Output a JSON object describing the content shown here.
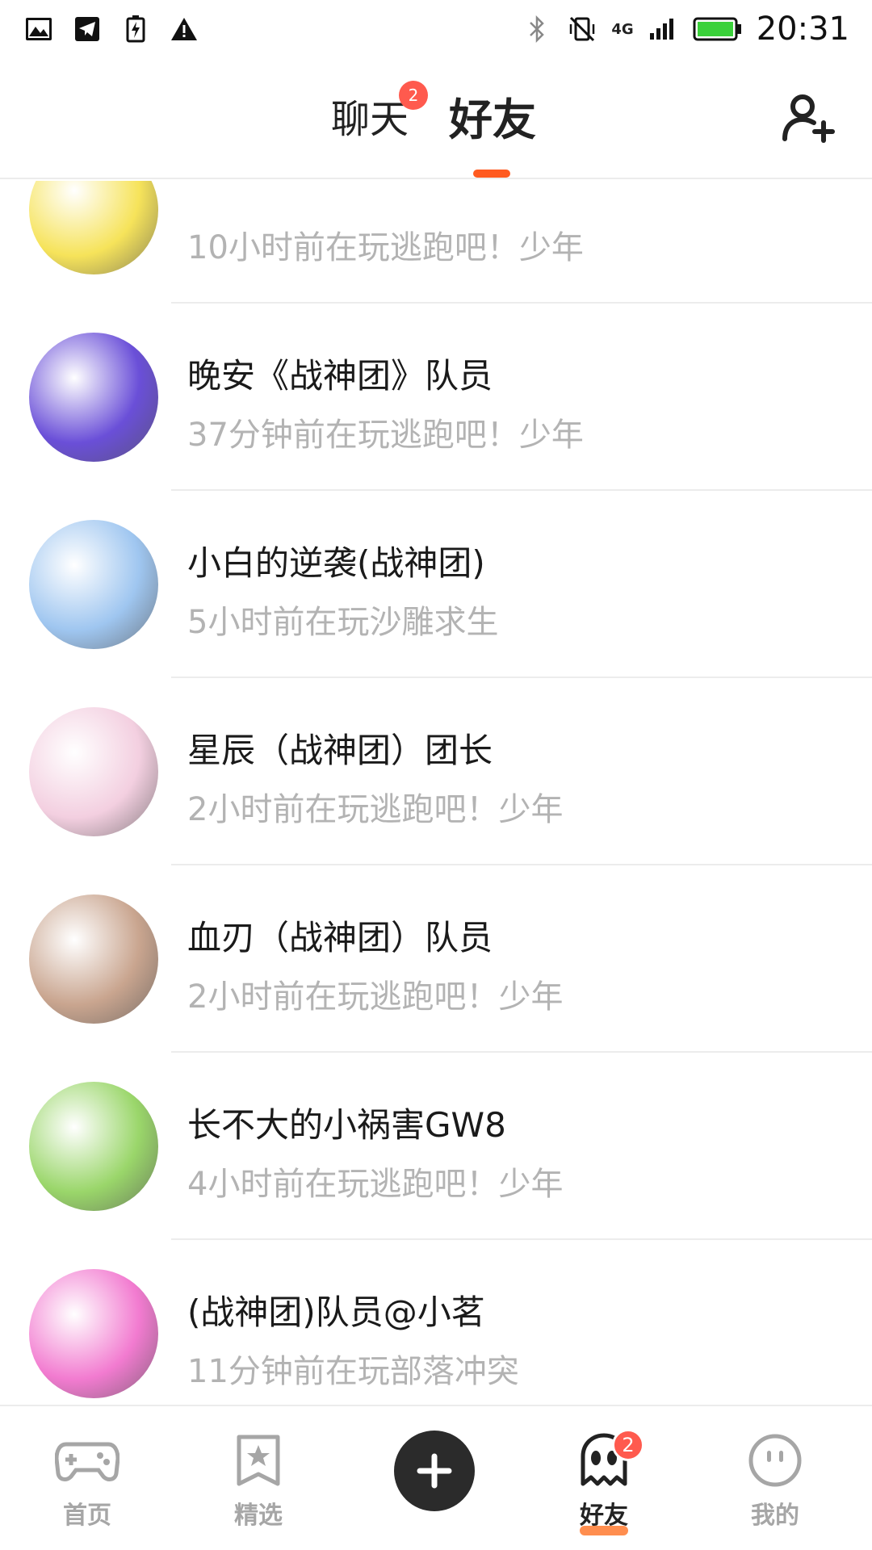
{
  "status_bar": {
    "time": "20:31",
    "network": "4G",
    "left_icons": [
      "image-icon",
      "telegram-icon",
      "battery-saver-icon",
      "warning-icon"
    ],
    "right_icons": [
      "bluetooth-icon",
      "vibrate-off-icon",
      "signal-icon",
      "battery-icon"
    ]
  },
  "header": {
    "tabs": [
      {
        "label": "聊天",
        "badge": "2",
        "active": false
      },
      {
        "label": "好友",
        "active": true
      }
    ],
    "accent_color": "#ff5a1f"
  },
  "friends": [
    {
      "name": "",
      "status": "10小时前在玩逃跑吧！少年",
      "avatar_color": "#f6e35a"
    },
    {
      "name": "晚安《战神团》队员",
      "status": "37分钟前在玩逃跑吧！少年",
      "avatar_color": "#6a4fd8"
    },
    {
      "name": "小白的逆袭(战神团)",
      "status": "5小时前在玩沙雕求生",
      "avatar_color": "#9fc6f0"
    },
    {
      "name": "星辰（战神团）团长",
      "status": "2小时前在玩逃跑吧！少年",
      "avatar_color": "#f3cfe0"
    },
    {
      "name": "血刃（战神团）队员",
      "status": "2小时前在玩逃跑吧！少年",
      "avatar_color": "#c9a58f"
    },
    {
      "name": "长不大的小祸害GW8",
      "status": "4小时前在玩逃跑吧！少年",
      "avatar_color": "#9ad66a"
    },
    {
      "name": "(战神团)队员@小茗",
      "status": "11分钟前在玩部落冲突",
      "avatar_color": "#f27bd0"
    }
  ],
  "bottom_nav": {
    "items": [
      {
        "label": "首页",
        "icon": "gamepad-icon"
      },
      {
        "label": "精选",
        "icon": "bookmark-star-icon"
      },
      {
        "label": "",
        "icon": "plus-icon"
      },
      {
        "label": "好友",
        "icon": "ghost-icon",
        "badge": "2",
        "active": true
      },
      {
        "label": "我的",
        "icon": "smiley-icon"
      }
    ]
  }
}
